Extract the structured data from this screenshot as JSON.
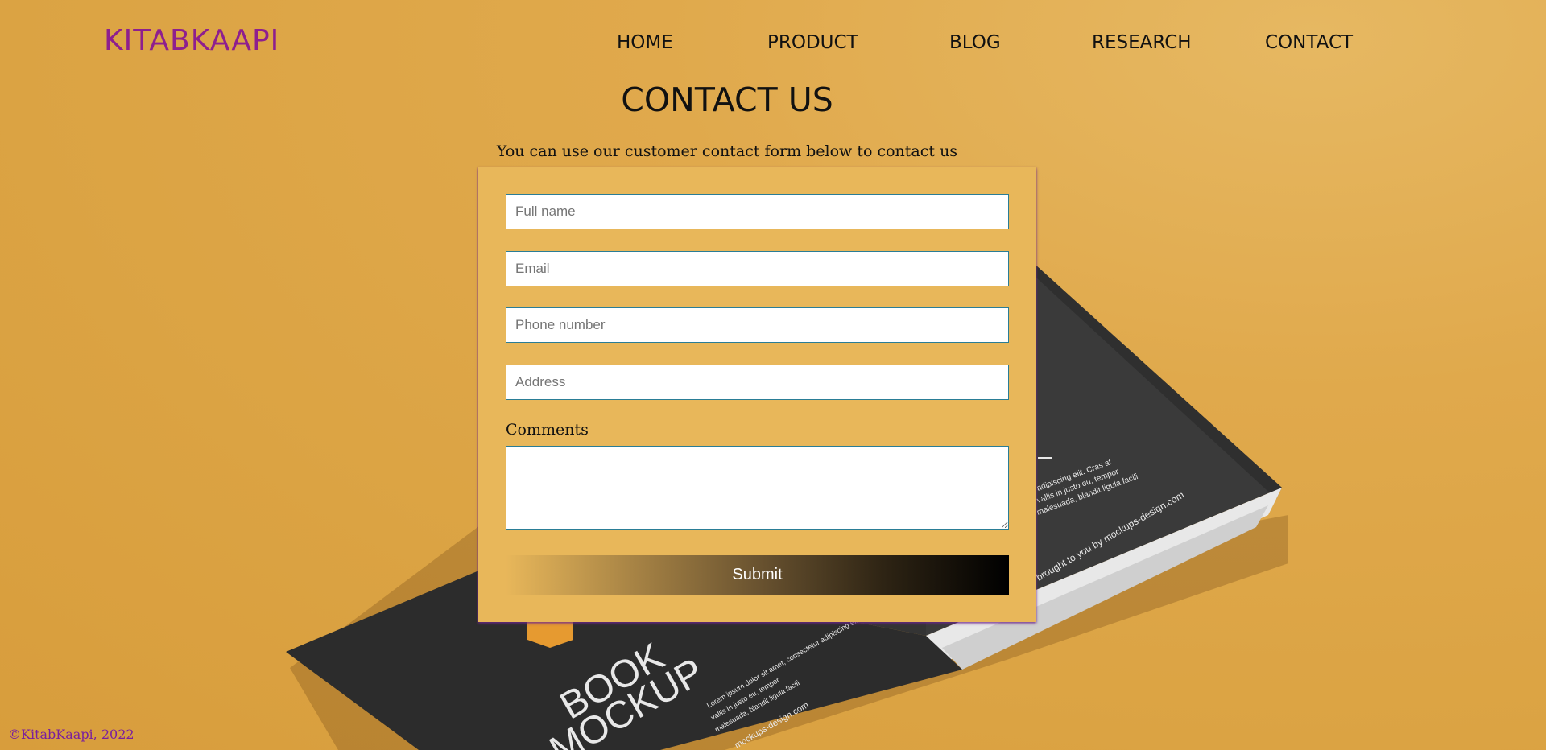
{
  "header": {
    "logo": "KITABKAAPI",
    "nav": [
      "HOME",
      "PRODUCT",
      "BLOG",
      "RESEARCH",
      "CONTACT"
    ]
  },
  "main": {
    "title": "CONTACT US",
    "subtitle": "You can use our customer contact form below to contact us"
  },
  "form": {
    "full_name_placeholder": "Full name",
    "email_placeholder": "Email",
    "phone_placeholder": "Phone number",
    "address_placeholder": "Address",
    "comments_label": "Comments",
    "submit_label": "Submit"
  },
  "background": {
    "book_title_line1": "BOOK",
    "book_title_line2": "MOCKUP",
    "book_credit": "brought to you by mockups-design.com"
  },
  "footer": {
    "copyright": "©KitabKaapi, 2022"
  },
  "colors": {
    "background": "#dba343",
    "logo": "#8e1f8e",
    "form_card": "#e8b75a",
    "input_border": "#2a7d96",
    "footer_text": "#7a1f9e"
  }
}
